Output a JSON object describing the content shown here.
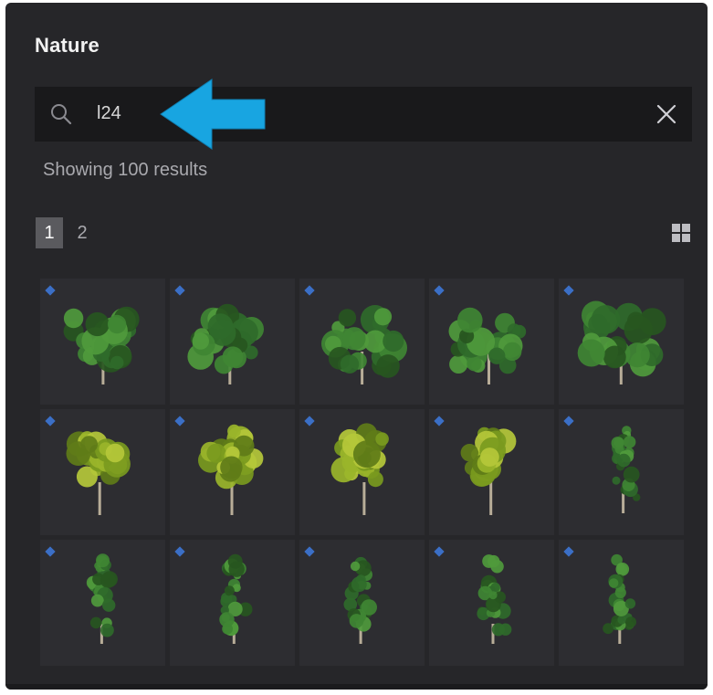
{
  "panel": {
    "title": "Nature"
  },
  "search": {
    "value": "l24"
  },
  "results": {
    "text": "Showing 100 results"
  },
  "pagination": {
    "pages": [
      "1",
      "2"
    ],
    "current": "1"
  },
  "colors": {
    "panel_bg": "#262629",
    "search_bg": "#19191b",
    "thumb_bg": "#2d2d31",
    "badge": "#3b6fc6",
    "arrow": "#1aa6e0"
  },
  "icons": {
    "search": "search-icon",
    "clear": "close-icon",
    "view": "grid-view-icon",
    "annotation": "arrow-left-icon"
  },
  "thumbnails": [
    {
      "kind": "broadleaf",
      "tone": "green"
    },
    {
      "kind": "broadleaf",
      "tone": "green"
    },
    {
      "kind": "broadleaf",
      "tone": "green"
    },
    {
      "kind": "broadleaf",
      "tone": "green"
    },
    {
      "kind": "broadleaf",
      "tone": "green"
    },
    {
      "kind": "rounded",
      "tone": "yellow-green"
    },
    {
      "kind": "rounded",
      "tone": "yellow-green"
    },
    {
      "kind": "rounded",
      "tone": "yellow-green"
    },
    {
      "kind": "rounded",
      "tone": "yellow-green"
    },
    {
      "kind": "columnar",
      "tone": "green"
    },
    {
      "kind": "columnar",
      "tone": "green"
    },
    {
      "kind": "columnar",
      "tone": "green"
    },
    {
      "kind": "columnar",
      "tone": "green"
    },
    {
      "kind": "columnar",
      "tone": "green"
    },
    {
      "kind": "columnar",
      "tone": "green"
    }
  ]
}
